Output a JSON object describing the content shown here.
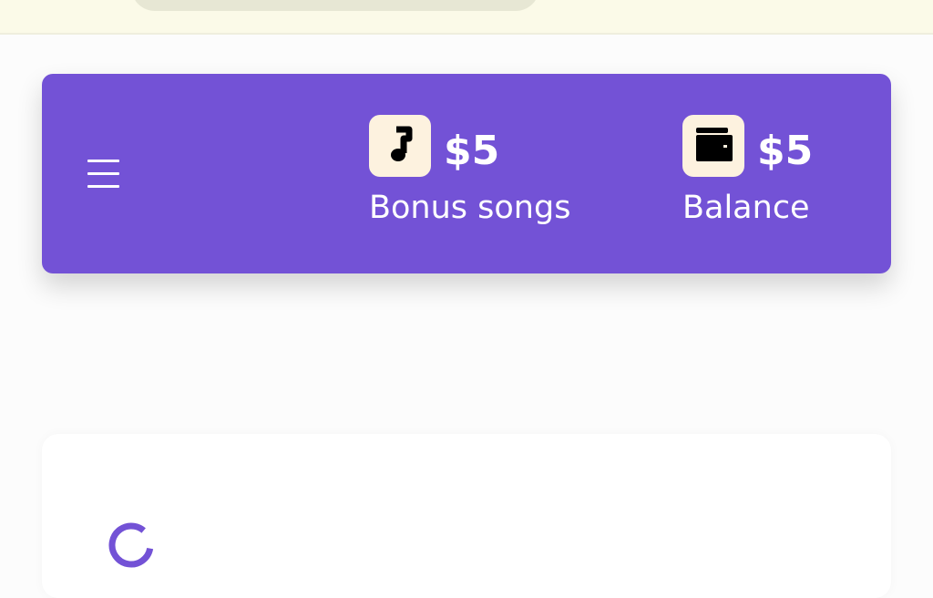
{
  "wallet": {
    "bonus_songs": {
      "amount": "$5",
      "label": "Bonus songs",
      "icon": "music-note-icon"
    },
    "balance": {
      "amount": "$5",
      "label": "Balance",
      "icon": "wallet-icon"
    }
  },
  "menu": {
    "icon": "hamburger-menu-icon"
  },
  "loading": {
    "icon": "loading-spinner-icon"
  },
  "colors": {
    "accent": "#7352d6",
    "icon_badge": "#fdf2df",
    "topbar": "#fbfae8"
  }
}
